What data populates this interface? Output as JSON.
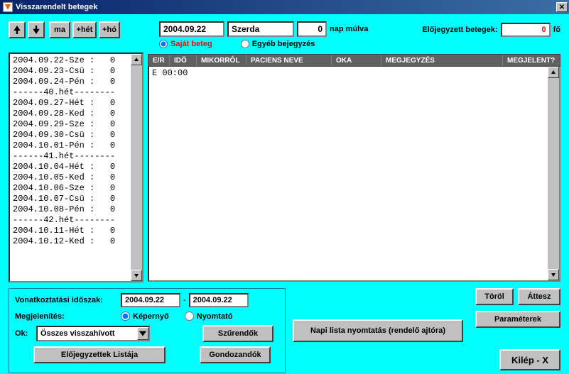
{
  "title": "Visszarendelt betegek",
  "nav": {
    "ma": "ma",
    "plus_het": "+hét",
    "plus_ho": "+hó"
  },
  "date": {
    "value": "2004.09.22",
    "dayname": "Szerda",
    "days_count": "0",
    "nap_mulva": "nap múlva"
  },
  "radios": {
    "sajat": "Saját beteg",
    "egyeb": "Egyéb bejegyzés"
  },
  "prebooked": {
    "label": "Előjegyzett betegek:",
    "value": "0",
    "unit": "fő"
  },
  "daylist": [
    "2004.09.22-Sze :   0",
    "2004.09.23-Csü :   0",
    "2004.09.24-Pén :   0",
    "------40.hét--------",
    "2004.09.27-Hét :   0",
    "2004.09.28-Ked :   0",
    "2004.09.29-Sze :   0",
    "2004.09.30-Csü :   0",
    "2004.10.01-Pén :   0",
    "------41.hét--------",
    "2004.10.04-Hét :   0",
    "2004.10.05-Ked :   0",
    "2004.10.06-Sze :   0",
    "2004.10.07-Csü :   0",
    "2004.10.08-Pén :   0",
    "------42.hét--------",
    "2004.10.11-Hét :   0",
    "2004.10.12-Ked :   0"
  ],
  "table": {
    "headers": [
      "E/R",
      "IDÖ",
      "MIKORRÓL",
      "PACIENS NEVE",
      "OKA",
      "MEGJEGYZÉS",
      "MEGJELENT?"
    ],
    "rows": [
      "E 00:00"
    ]
  },
  "bottom": {
    "period_label": "Vonatkoztatási időszak:",
    "from": "2004.09.22",
    "to": "2004.09.22",
    "view_label": "Megjelenítés:",
    "screen": "Képernyő",
    "printer": "Nyomtató",
    "ok_label": "Ok:",
    "ok_value": "Összes visszahívott",
    "filters": "Szűrendők",
    "prebooked_list": "Előjegyzettek Listája",
    "gondozandok": "Gondozandók"
  },
  "actions": {
    "torol": "Töröl",
    "attesz": "Áttesz",
    "params": "Paraméterek",
    "kilep": "Kilép - X",
    "print_daily": "Napi lista nyomtatás (rendelő ajtóra)"
  }
}
